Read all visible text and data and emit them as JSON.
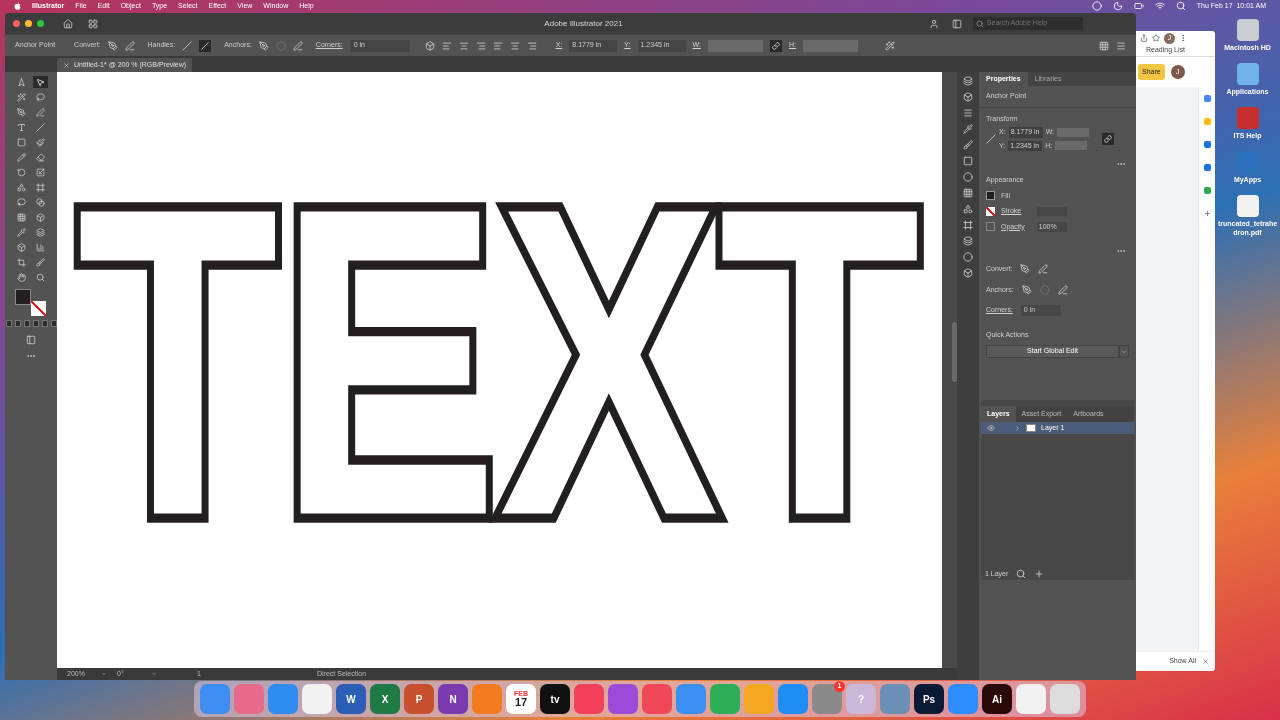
{
  "menu_bar": {
    "app": "Illustrator",
    "items": [
      "File",
      "Edit",
      "Object",
      "Type",
      "Select",
      "Effect",
      "View",
      "Window",
      "Help"
    ],
    "clock": "Thu Feb 17  10:01 AM"
  },
  "window": {
    "title": "Adobe Illustrator 2021",
    "search_placeholder": "Search Adobe Help"
  },
  "control_bar": {
    "mode": "Anchor Point",
    "convert_label": "Convert:",
    "handles_label": "Handles:",
    "anchors_label": "Anchors:",
    "corners_label": "Corners:",
    "corners_value": "0 in",
    "x_label": "X:",
    "x_value": "8.1779 in",
    "y_label": "Y:",
    "y_value": "1.2345 in",
    "w_label": "W:",
    "h_label": "H:"
  },
  "document_tab": {
    "title": "Untitled-1* @ 200 % (RGB/Preview)"
  },
  "artwork": {
    "text": "TEXT"
  },
  "tools": [
    {
      "selected": false
    },
    {
      "selected": true
    },
    {
      "selected": false
    },
    {
      "selected": false
    },
    {
      "selected": false
    },
    {
      "selected": false
    },
    {
      "selected": false
    },
    {
      "selected": false
    },
    {
      "selected": false
    },
    {
      "selected": false
    },
    {
      "selected": false
    },
    {
      "selected": false
    },
    {
      "selected": false
    },
    {
      "selected": false
    },
    {
      "selected": false
    },
    {
      "selected": false
    },
    {
      "selected": false
    },
    {
      "selected": false
    },
    {
      "selected": false
    },
    {
      "selected": false
    },
    {
      "selected": false
    },
    {
      "selected": false
    },
    {
      "selected": false
    },
    {
      "selected": false
    },
    {
      "selected": false
    },
    {
      "selected": false
    },
    {
      "selected": false
    },
    {
      "selected": false
    },
    {
      "selected": false
    },
    {
      "selected": false
    },
    {
      "selected": false
    },
    {
      "selected": false
    },
    {
      "selected": false
    },
    {
      "selected": false
    }
  ],
  "properties": {
    "tabs": [
      {
        "label": "Properties",
        "selected": true
      },
      {
        "label": "Libraries",
        "selected": false
      }
    ],
    "selection_type": "Anchor Point",
    "transform": {
      "title": "Transform",
      "x_label": "X:",
      "x": "8.1779 in",
      "y_label": "Y:",
      "y": "1.2345 in",
      "w_label": "W:",
      "h_label": "H:"
    },
    "appearance": {
      "title": "Appearance",
      "fill_label": "Fill",
      "stroke_label": "Stroke",
      "opacity_label": "Opacity",
      "opacity": "100%"
    },
    "convert_label": "Convert:",
    "anchors_label": "Anchors:",
    "corners_label": "Corners:",
    "corners": "0 in",
    "quick_actions": {
      "title": "Quick Actions",
      "button": "Start Global Edit"
    }
  },
  "layers_panel": {
    "tabs": [
      {
        "label": "Layers",
        "selected": true
      },
      {
        "label": "Asset Export",
        "selected": false
      },
      {
        "label": "Artboards",
        "selected": false
      }
    ],
    "layers": [
      {
        "name": "Layer 1",
        "selected": true,
        "visible": true
      }
    ],
    "footer": "1 Layer"
  },
  "status_bar": {
    "zoom": "200%",
    "rotation": "0°",
    "artboard": "1",
    "tool": "Direct Selection"
  },
  "browser": {
    "toolbar_avatar": "J",
    "reading_list": "Reading List",
    "share": "Share",
    "avatar": "J",
    "show_all": "Show All"
  },
  "desktop_icons": [
    {
      "name": "Macintosh HD",
      "color": "#c9ccd1"
    },
    {
      "name": "Applications",
      "color": "#6fb3e8"
    },
    {
      "name": "ITS Help",
      "color": "#c8302f"
    },
    {
      "name": "MyApps",
      "color": "#2a6fb8"
    },
    {
      "name": "truncated_tetrahe dron.pdf",
      "color": "#f2f2f2"
    }
  ],
  "dock": [
    {
      "color": "#3d8ef0"
    },
    {
      "color": "#e86a8a"
    },
    {
      "color": "#2f8cf0"
    },
    {
      "color": "#f2f2f2"
    },
    {
      "color": "#2b5fb5",
      "label": "W"
    },
    {
      "color": "#1f7a45",
      "label": "X"
    },
    {
      "color": "#c9502e",
      "label": "P"
    },
    {
      "color": "#7b3bb0",
      "label": "N"
    },
    {
      "color": "#f47a1f"
    },
    {
      "color": "#ffffff",
      "label": "FEB",
      "sub": "17"
    },
    {
      "color": "#111111",
      "label": "tv"
    },
    {
      "color": "#f2405a"
    },
    {
      "color": "#9b4bd8"
    },
    {
      "color": "#f0485a"
    },
    {
      "color": "#3a8ff0"
    },
    {
      "color": "#2fae5a"
    },
    {
      "color": "#f5a623"
    },
    {
      "color": "#1e8ef5"
    },
    {
      "color": "#8a8a8a",
      "badge": "1"
    },
    {
      "color": "#c9b8d8",
      "label": "?"
    },
    {
      "color": "#6c8fb5"
    },
    {
      "color": "#0a1a35",
      "label": "Ps"
    },
    {
      "color": "#2d8cff"
    },
    {
      "color": "#2a0a05",
      "label": "Ai"
    },
    {
      "color": "#f2f2f2"
    },
    {
      "color": "#dcdcdc"
    }
  ]
}
